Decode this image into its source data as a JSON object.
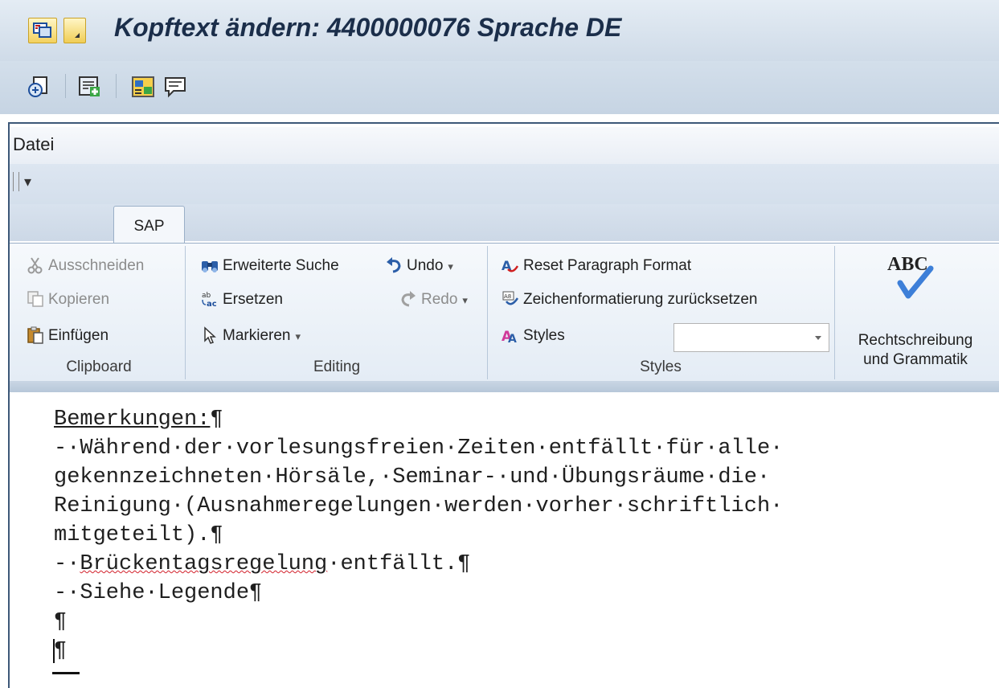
{
  "window": {
    "title": "Kopftext ändern: 4400000076 Sprache DE"
  },
  "app_toolbar": {
    "icons": [
      "document-header-icon",
      "insert-text-icon",
      "program-icon",
      "comment-icon"
    ]
  },
  "editor": {
    "menu": [
      "Datei"
    ],
    "quick_access": {
      "dropdown_glyph": "▾"
    },
    "tabs": [
      {
        "label": "SAP",
        "selected": true
      }
    ]
  },
  "ribbon": {
    "clipboard": {
      "label": "Clipboard",
      "cut": "Ausschneiden",
      "copy": "Kopieren",
      "paste": "Einfügen"
    },
    "editing": {
      "label": "Editing",
      "advanced_find": "Erweiterte Suche",
      "replace": "Ersetzen",
      "select": "Markieren",
      "undo": "Undo",
      "redo": "Redo"
    },
    "styles": {
      "label": "Styles",
      "reset_paragraph": "Reset Paragraph Format",
      "reset_character": "Zeichenformatierung zurücksetzen",
      "styles": "Styles",
      "combo_value": ""
    },
    "proofing": {
      "abc": "ABC",
      "spell_line1": "Rechtschreibung",
      "spell_line2": "und Grammatik"
    }
  },
  "document": {
    "heading": "Bemerkungen:",
    "pilcrow": "¶",
    "line1": "-·Während·der·vorlesungsfreien·Zeiten·entfällt·für·alle·",
    "line2": "gekennzeichneten·Hörsäle,·Seminar-·und·Übungsräume·die·",
    "line3": "Reinigung·(Ausnahmeregelungen·werden·vorher·schriftlich·",
    "line4": "mitgeteilt).",
    "line5_prefix": "-·",
    "line5_word": "Brückentagsregelung",
    "line5_rest": "·entfällt.",
    "line6": "-·Siehe·Legende"
  }
}
